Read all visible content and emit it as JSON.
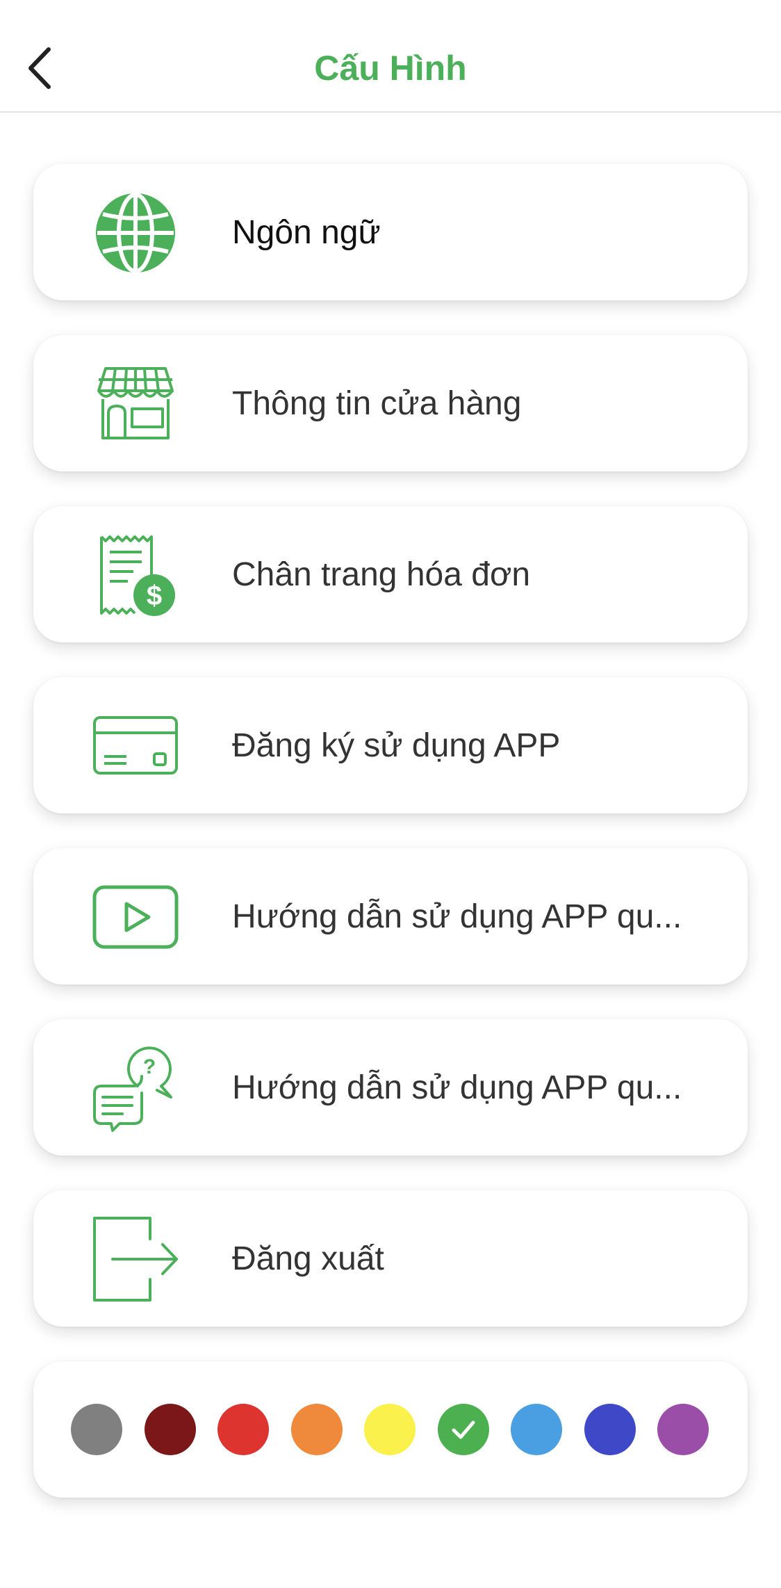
{
  "header": {
    "title": "Cấu Hình",
    "back_icon": "chevron-left-icon"
  },
  "menu": [
    {
      "label": "Ngôn ngữ",
      "icon": "globe-icon"
    },
    {
      "label": "Thông tin cửa hàng",
      "icon": "store-icon"
    },
    {
      "label": "Chân trang hóa đơn",
      "icon": "receipt-dollar-icon"
    },
    {
      "label": "Đăng ký sử dụng APP",
      "icon": "credit-card-icon"
    },
    {
      "label": "Hướng dẫn sử dụng APP qu...",
      "icon": "video-play-icon"
    },
    {
      "label": "Hướng dẫn sử dụng APP qu...",
      "icon": "chat-question-icon"
    },
    {
      "label": "Đăng xuất",
      "icon": "logout-icon"
    }
  ],
  "theme": {
    "accent": "#4caf5a",
    "selected_color_index": 5,
    "colors": [
      "#808080",
      "#7b1619",
      "#dd3430",
      "#ef8a3c",
      "#fbf14d",
      "#4caf50",
      "#4a9fe3",
      "#3f48c6",
      "#9b4ea7"
    ]
  }
}
